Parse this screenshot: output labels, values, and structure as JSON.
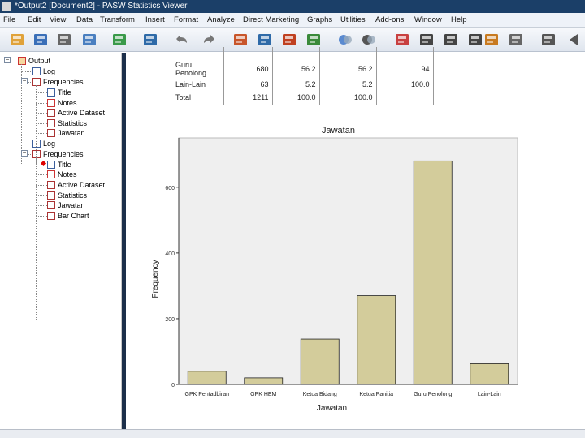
{
  "window": {
    "title": "*Output2 [Document2] - PASW Statistics Viewer"
  },
  "menu": [
    "File",
    "Edit",
    "View",
    "Data",
    "Transform",
    "Insert",
    "Format",
    "Analyze",
    "Direct Marketing",
    "Graphs",
    "Utilities",
    "Add-ons",
    "Window",
    "Help"
  ],
  "toolbar_icons": [
    "open-icon",
    "save-icon",
    "print-icon",
    "print-preview-icon",
    "export-icon",
    "goto-data-icon",
    "undo-icon",
    "redo-icon",
    "goto-case-icon",
    "goto-variable-icon",
    "insert-output-icon",
    "variables-icon",
    "select-icon",
    "show-all-icon",
    "designate-window-icon",
    "promote-icon",
    "demote-icon",
    "collapse-icon",
    "expand-icon",
    "show-icon",
    "hide-icon",
    "back-icon",
    "forward-icon"
  ],
  "outline": [
    {
      "label": "Output",
      "level": 0,
      "icon": "output-book-icon"
    },
    {
      "label": "Log",
      "level": 1,
      "icon": "log-icon"
    },
    {
      "label": "Frequencies",
      "level": 1,
      "icon": "frequencies-icon"
    },
    {
      "label": "Title",
      "level": 2,
      "icon": "title-icon"
    },
    {
      "label": "Notes",
      "level": 2,
      "icon": "notes-icon"
    },
    {
      "label": "Active Dataset",
      "level": 2,
      "icon": "dataset-icon"
    },
    {
      "label": "Statistics",
      "level": 2,
      "icon": "statistics-icon"
    },
    {
      "label": "Jawatan",
      "level": 2,
      "icon": "table-icon"
    },
    {
      "label": "Log",
      "level": 1,
      "icon": "log-icon"
    },
    {
      "label": "Frequencies",
      "level": 1,
      "icon": "frequencies-icon"
    },
    {
      "label": "Title",
      "level": 2,
      "icon": "title-icon"
    },
    {
      "label": "Notes",
      "level": 2,
      "icon": "notes-icon"
    },
    {
      "label": "Active Dataset",
      "level": 2,
      "icon": "dataset-icon"
    },
    {
      "label": "Statistics",
      "level": 2,
      "icon": "statistics-icon"
    },
    {
      "label": "Jawatan",
      "level": 2,
      "icon": "table-icon"
    },
    {
      "label": "Bar Chart",
      "level": 2,
      "icon": "bar-chart-icon"
    }
  ],
  "frequency_table": {
    "rows": [
      {
        "label": "",
        "values": [
          "",
          "",
          "",
          ""
        ]
      },
      {
        "label": "Guru Penolong",
        "values": [
          "680",
          "56.2",
          "56.2",
          "94"
        ]
      },
      {
        "label": "Lain-Lain",
        "values": [
          "63",
          "5.2",
          "5.2",
          "100.0"
        ]
      },
      {
        "label": "Total",
        "values": [
          "1211",
          "100.0",
          "100.0",
          ""
        ]
      }
    ]
  },
  "chart_data": {
    "type": "bar",
    "title": "Jawatan",
    "xlabel": "Jawatan",
    "ylabel": "Frequency",
    "categories": [
      "GPK Pentadbiran",
      "GPK HEM",
      "Ketua Bidang",
      "Ketua Panitia",
      "Guru Penolong",
      "Lain-Lain"
    ],
    "values": [
      40,
      20,
      138,
      270,
      680,
      63
    ],
    "yticks": [
      0,
      200,
      400,
      600
    ],
    "ylim": [
      0,
      750
    ],
    "grid": false,
    "colors": {
      "bar": "#d3cc9b",
      "bar_stroke": "#222222",
      "plot_bg": "#efefef"
    }
  }
}
